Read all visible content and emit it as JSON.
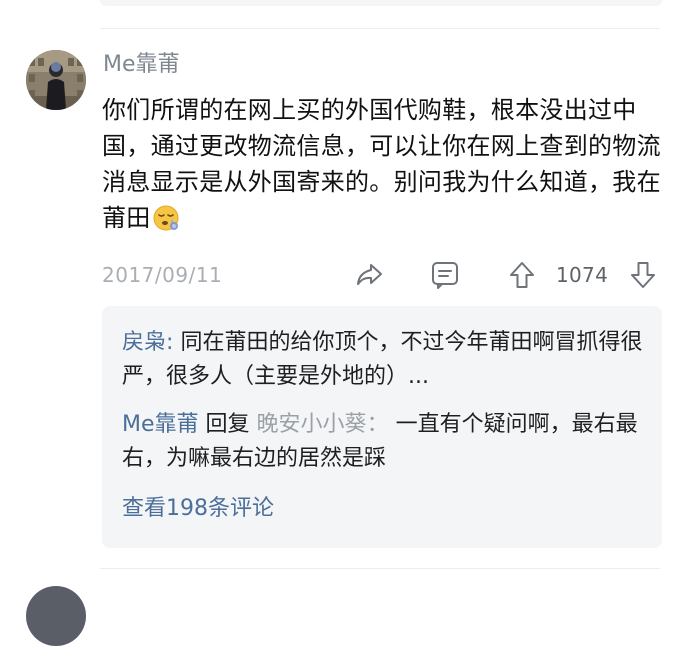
{
  "comment": {
    "username": "Me靠莆",
    "text": "你们所谓的在网上买的外国代购鞋，根本没出过中国，通过更改物流信息，可以让你在网上查到的物流消息显示是从外国寄来的。别问我为什么知道，我在莆田",
    "emoji_icon": "sleepy-face-icon",
    "date": "2017/09/11",
    "vote_count": "1074",
    "actions": [
      "share-icon",
      "comment-icon",
      "upvote-arrow-icon",
      "downvote-arrow-icon"
    ]
  },
  "replies": {
    "items": [
      {
        "author": "戻枭",
        "separator": ":",
        "text": "同在莆田的给你顶个，不过今年莆田啊冒抓得很严，很多人（主要是外地的）..."
      },
      {
        "author": "Me靠莆",
        "reply_word": "回复",
        "reply_to": "晚安小小葵",
        "separator": "：",
        "text": "一直有个疑问啊，最右最右，为嘛最右边的居然是踩"
      }
    ],
    "view_all": "查看198条评论"
  },
  "colors": {
    "username": "#7f8791",
    "reply_name": "#4b6f99",
    "reply_target": "#9aa0a6",
    "reply_bg": "#f4f5f7",
    "date": "#a9aeb4"
  }
}
